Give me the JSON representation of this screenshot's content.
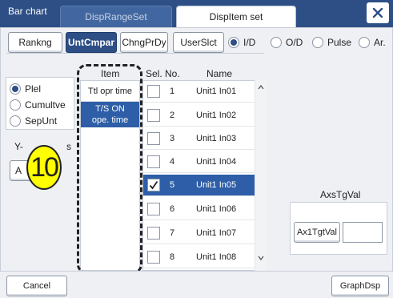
{
  "window": {
    "title": "Bar chart"
  },
  "tabs": [
    {
      "label": "DispRangeSet"
    },
    {
      "label": "DispItem set"
    }
  ],
  "toolbar": {
    "buttons": [
      "Rankng",
      "UntCmpar",
      "ChngPrDy",
      "UserSlct"
    ],
    "active_button": "UntCmpar",
    "radios": [
      "I/D",
      "O/D",
      "Pulse",
      "Ar."
    ],
    "selected_radio": "I/D"
  },
  "left_group": {
    "options": [
      "Plel",
      "Cumultve",
      "SepUnt"
    ],
    "selected": "Plel",
    "hidden_label_fragment": "Y-",
    "hidden_label_fragment2": "s",
    "hidden_button_fragment": "A"
  },
  "item_list": {
    "header": "Item",
    "items": [
      "Ttl opr time",
      "T/S ON\nope. time"
    ],
    "selected_index": 1
  },
  "table": {
    "headers": {
      "sel": "Sel.",
      "no": "No.",
      "name": "Name"
    },
    "rows": [
      {
        "no": "1",
        "name": "Unit1 In01",
        "checked": false
      },
      {
        "no": "2",
        "name": "Unit1 In02",
        "checked": false
      },
      {
        "no": "3",
        "name": "Unit1 In03",
        "checked": false
      },
      {
        "no": "4",
        "name": "Unit1 In04",
        "checked": false
      },
      {
        "no": "5",
        "name": "Unit1 In05",
        "checked": true
      },
      {
        "no": "6",
        "name": "Unit1 In06",
        "checked": false
      },
      {
        "no": "7",
        "name": "Unit1 In07",
        "checked": false
      },
      {
        "no": "8",
        "name": "Unit1 In08",
        "checked": false
      }
    ],
    "selected_row": 4
  },
  "axis": {
    "label": "AxsTgVal",
    "button": "Ax1TgtVal",
    "value": ""
  },
  "callout": {
    "number": "10"
  },
  "footer": {
    "cancel": "Cancel",
    "graph": "GraphDsp"
  },
  "colors": {
    "title_bar": "#2d4f86",
    "selection": "#2d5ea7",
    "callout": "#ffff00"
  },
  "icons": {
    "close": "close-icon",
    "check": "check-icon",
    "scroll_up": "chevron-up-icon",
    "scroll_down": "chevron-down-icon"
  }
}
